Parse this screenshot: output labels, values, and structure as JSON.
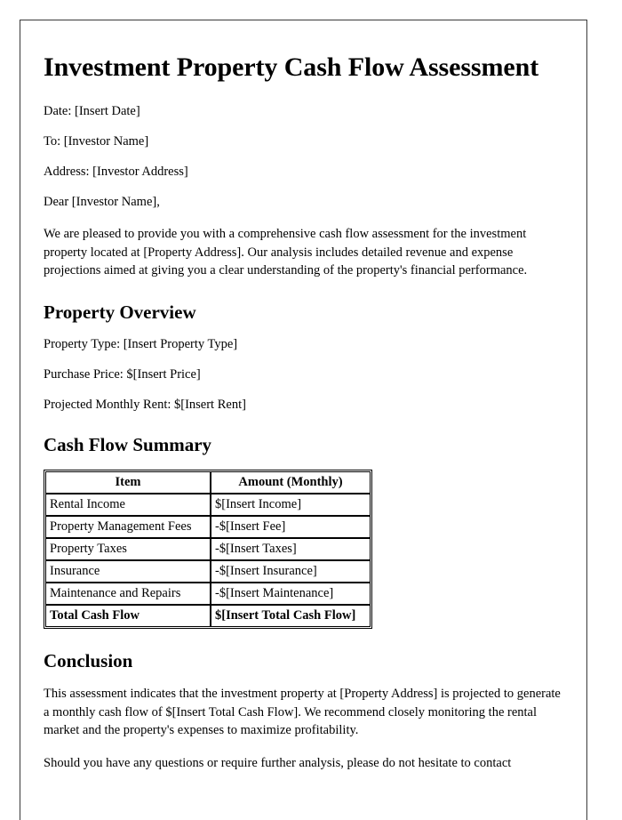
{
  "document": {
    "title": "Investment Property Cash Flow Assessment",
    "meta": {
      "date_line": "Date: [Insert Date]",
      "to_line": "To: [Investor Name]",
      "address_line": "Address: [Investor Address]",
      "salutation": "Dear [Investor Name],"
    },
    "intro_paragraph": "We are pleased to provide you with a comprehensive cash flow assessment for the investment property located at [Property Address]. Our analysis includes detailed revenue and expense projections aimed at giving you a clear understanding of the property's financial performance.",
    "property_overview": {
      "heading": "Property Overview",
      "lines": [
        "Property Type: [Insert Property Type]",
        "Purchase Price: $[Insert Price]",
        "Projected Monthly Rent: $[Insert Rent]"
      ]
    },
    "cash_flow_summary": {
      "heading": "Cash Flow Summary",
      "columns": [
        "Item",
        "Amount (Monthly)"
      ],
      "rows": [
        {
          "item": "Rental Income",
          "amount": "$[Insert Income]"
        },
        {
          "item": "Property Management Fees",
          "amount": "-$[Insert Fee]"
        },
        {
          "item": "Property Taxes",
          "amount": "-$[Insert Taxes]"
        },
        {
          "item": "Insurance",
          "amount": "-$[Insert Insurance]"
        },
        {
          "item": "Maintenance and Repairs",
          "amount": "-$[Insert Maintenance]"
        }
      ],
      "total_row": {
        "item": "Total Cash Flow",
        "amount": "$[Insert Total Cash Flow]"
      }
    },
    "conclusion": {
      "heading": "Conclusion",
      "paragraph_1": "This assessment indicates that the investment property at [Property Address] is projected to generate a monthly cash flow of $[Insert Total Cash Flow]. We recommend closely monitoring the rental market and the property's expenses to maximize profitability.",
      "paragraph_2": "Should you have any questions or require further analysis, please do not hesitate to contact"
    }
  }
}
